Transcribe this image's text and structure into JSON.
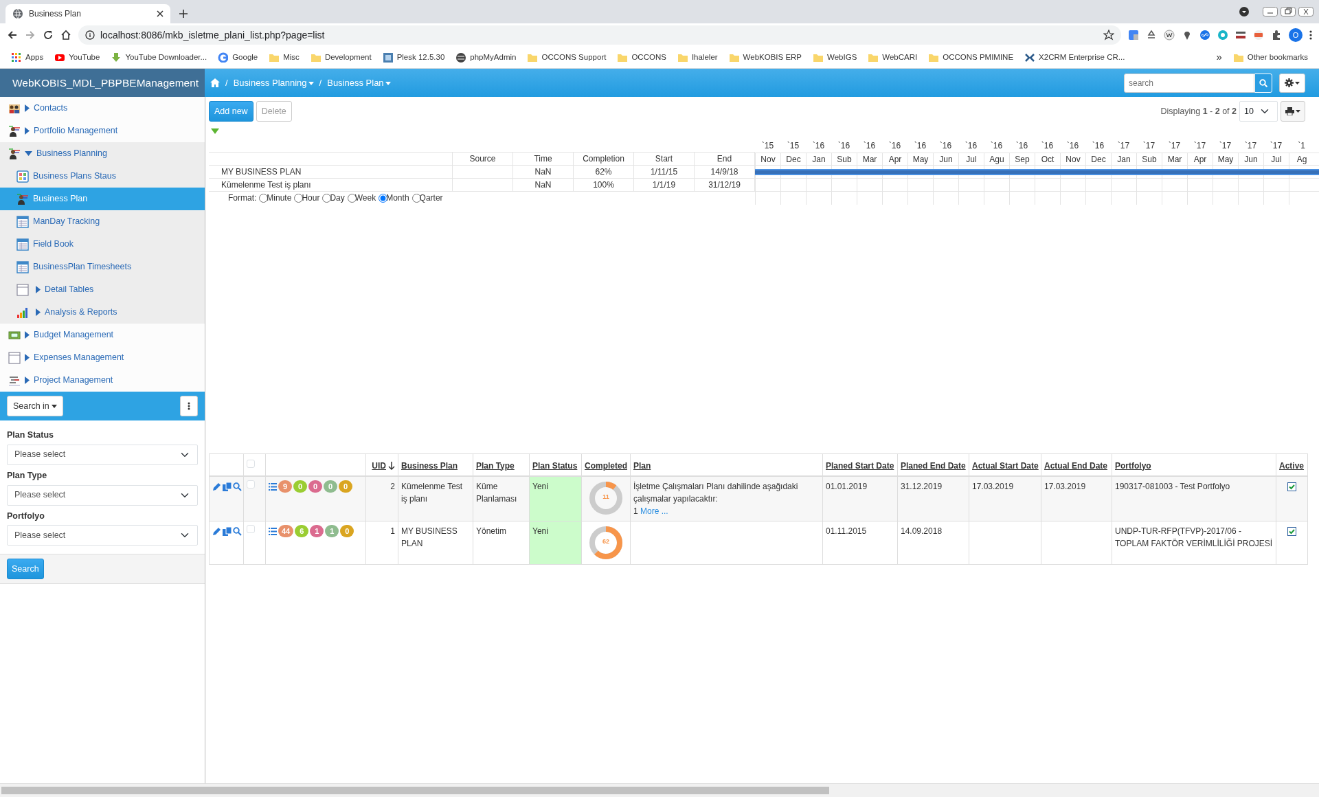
{
  "browser": {
    "tab_title": "Business Plan",
    "url": "localhost:8086/mkb_isletme_plani_list.php?page=list",
    "profile_initial": "O",
    "bookmarks": [
      {
        "label": "Apps",
        "kind": "apps"
      },
      {
        "label": "YouTube",
        "kind": "youtube"
      },
      {
        "label": "YouTube Downloader...",
        "kind": "download"
      },
      {
        "label": "Google",
        "kind": "google"
      },
      {
        "label": "Misc",
        "kind": "folder"
      },
      {
        "label": "Development",
        "kind": "folder"
      },
      {
        "label": "Plesk 12.5.30",
        "kind": "plesk"
      },
      {
        "label": "phpMyAdmin",
        "kind": "globe"
      },
      {
        "label": "OCCONS Support",
        "kind": "folder"
      },
      {
        "label": "OCCONS",
        "kind": "folder"
      },
      {
        "label": "Ihaleler",
        "kind": "folder"
      },
      {
        "label": "WebKOBIS ERP",
        "kind": "folder"
      },
      {
        "label": "WebIGS",
        "kind": "folder"
      },
      {
        "label": "WebCARI",
        "kind": "folder"
      },
      {
        "label": "OCCONS PMIMINE",
        "kind": "folder"
      },
      {
        "label": "X2CRM Enterprise CR...",
        "kind": "x2"
      }
    ],
    "more": "»",
    "other_bookmarks": "Other bookmarks"
  },
  "app": {
    "title": "WebKOBIS_MDL_PBPBEManagement",
    "breadcrumbs": [
      {
        "separator": "/",
        "label": "Business Planning"
      },
      {
        "separator": "/",
        "label": "Business Plan"
      }
    ],
    "search": {
      "placeholder": "search"
    }
  },
  "sidebar": {
    "items": [
      {
        "label": "Contacts",
        "kind": "people",
        "expanded": false,
        "selected": false
      },
      {
        "label": "Portfolio Management",
        "kind": "person",
        "expanded": false,
        "selected": false
      },
      {
        "label": "Business Planning",
        "kind": "person",
        "expanded": true,
        "selected": false,
        "children": [
          {
            "label": "Business Plans Staus",
            "kind": "grid",
            "selected": false
          },
          {
            "label": "Business Plan",
            "kind": "person",
            "selected": true
          },
          {
            "label": "ManDay Tracking",
            "kind": "table",
            "selected": false
          },
          {
            "label": "Field Book",
            "kind": "table",
            "selected": false
          },
          {
            "label": "BusinessPlan Timesheets",
            "kind": "table",
            "selected": false
          },
          {
            "label": "Detail Tables",
            "kind": "blank",
            "expanded": false,
            "selected": false
          },
          {
            "label": "Analysis & Reports",
            "kind": "chart",
            "expanded": false,
            "selected": false
          }
        ]
      },
      {
        "label": "Budget Management",
        "kind": "money",
        "expanded": false,
        "selected": false
      },
      {
        "label": "Expenses Management",
        "kind": "blank",
        "expanded": false,
        "selected": false
      },
      {
        "label": "Project Management",
        "kind": "lines",
        "expanded": false,
        "selected": false
      }
    ]
  },
  "search_panel": {
    "search_in": "Search in",
    "filters": [
      {
        "label": "Plan Status",
        "placeholder": "Please select"
      },
      {
        "label": "Plan Type",
        "placeholder": "Please select"
      },
      {
        "label": "Portfolyo",
        "placeholder": "Please select"
      }
    ],
    "search_button": "Search"
  },
  "toolbar": {
    "add_new": {
      "label": "Add new",
      "disabled": false
    },
    "delete": {
      "label": "Delete",
      "disabled": true
    },
    "displaying": "Displaying **1** - **2** of **2**",
    "page_size": "10"
  },
  "gantt": {
    "columns": [
      "Source",
      "Time",
      "Completion",
      "Start",
      "End"
    ],
    "rows": [
      {
        "name": "MY BUSINESS PLAN",
        "time": "NaN",
        "completion": "62%",
        "start": "1/11/15",
        "end": "14/9/18",
        "bar_shown": true
      },
      {
        "name": "Kümelenme Test iş planı",
        "time": "NaN",
        "completion": "100%",
        "start": "1/1/19",
        "end": "31/12/19",
        "bar_shown": false
      }
    ],
    "months": [
      {
        "year": "`15",
        "month": "Nov"
      },
      {
        "year": "`15",
        "month": "Dec"
      },
      {
        "year": "`16",
        "month": "Jan"
      },
      {
        "year": "`16",
        "month": "Sub"
      },
      {
        "year": "`16",
        "month": "Mar"
      },
      {
        "year": "`16",
        "month": "Apr"
      },
      {
        "year": "`16",
        "month": "May"
      },
      {
        "year": "`16",
        "month": "Jun"
      },
      {
        "year": "`16",
        "month": "Jul"
      },
      {
        "year": "`16",
        "month": "Agu"
      },
      {
        "year": "`16",
        "month": "Sep"
      },
      {
        "year": "`16",
        "month": "Oct"
      },
      {
        "year": "`16",
        "month": "Nov"
      },
      {
        "year": "`16",
        "month": "Dec"
      },
      {
        "year": "`17",
        "month": "Jan"
      },
      {
        "year": "`17",
        "month": "Sub"
      },
      {
        "year": "`17",
        "month": "Mar"
      },
      {
        "year": "`17",
        "month": "Apr"
      },
      {
        "year": "`17",
        "month": "May"
      },
      {
        "year": "`17",
        "month": "Jun"
      },
      {
        "year": "`17",
        "month": "Jul"
      },
      {
        "year": "`1",
        "month": "Ag"
      }
    ],
    "format": {
      "label": "Format:",
      "options": [
        {
          "label": "Minute",
          "selected": false
        },
        {
          "label": "Hour",
          "selected": false
        },
        {
          "label": "Day",
          "selected": false
        },
        {
          "label": "Week",
          "selected": false
        },
        {
          "label": "Month",
          "selected": true
        },
        {
          "label": "Qarter",
          "selected": false
        }
      ]
    }
  },
  "table": {
    "select_all_checked": false,
    "columns": [
      {
        "label": "UID",
        "sorted_descending": true
      },
      {
        "label": "Business Plan"
      },
      {
        "label": "Plan Type"
      },
      {
        "label": "Plan Status"
      },
      {
        "label": "Completed"
      },
      {
        "label": "Plan"
      },
      {
        "label": "Planed Start Date"
      },
      {
        "label": "Planed End Date"
      },
      {
        "label": "Actual Start Date"
      },
      {
        "label": "Actual End Date"
      },
      {
        "label": "Portfolyo"
      },
      {
        "label": "Active"
      }
    ],
    "rows": [
      {
        "checked": false,
        "badges": [
          {
            "value": "9",
            "color": "#e8916b"
          },
          {
            "value": "0",
            "color": "#9acd32"
          },
          {
            "value": "0",
            "color": "#db6b8f"
          },
          {
            "value": "0",
            "color": "#8fbc8f"
          },
          {
            "value": "0",
            "color": "#daa520"
          }
        ],
        "uid": "2",
        "business_plan": "Kümelenme Test iş planı",
        "plan_type": "Küme Planlaması",
        "plan_status": "Yeni",
        "completed": {
          "level": 0.11,
          "label": "11"
        },
        "plan": "İşletme Çalışmaları Planı dahilinde aşağıdaki çalışmalar yapılacaktır:",
        "more_count": "1",
        "more_link": "More ...",
        "planned_start": "01.01.2019",
        "planned_end": "31.12.2019",
        "actual_start": "17.03.2019",
        "actual_end": "17.03.2019",
        "portfolyo": "190317-081003 - Test Portfolyo",
        "active": true
      },
      {
        "checked": false,
        "badges": [
          {
            "value": "44",
            "color": "#e8916b"
          },
          {
            "value": "6",
            "color": "#9acd32"
          },
          {
            "value": "1",
            "color": "#db6b8f"
          },
          {
            "value": "1",
            "color": "#8fbc8f"
          },
          {
            "value": "0",
            "color": "#daa520"
          }
        ],
        "uid": "1",
        "business_plan": "MY BUSINESS PLAN",
        "plan_type": "Yönetim",
        "plan_status": "Yeni",
        "completed": {
          "level": 0.62,
          "label": "62"
        },
        "planned_start": "01.11.2015",
        "planned_end": "14.09.2018",
        "portfolyo": "UNDP-TUR-RFP(TFVP)-2017/06 - TOPLAM FAKTÖR VERİMLİLİĞİ PROJESİ",
        "active": true
      }
    ]
  }
}
